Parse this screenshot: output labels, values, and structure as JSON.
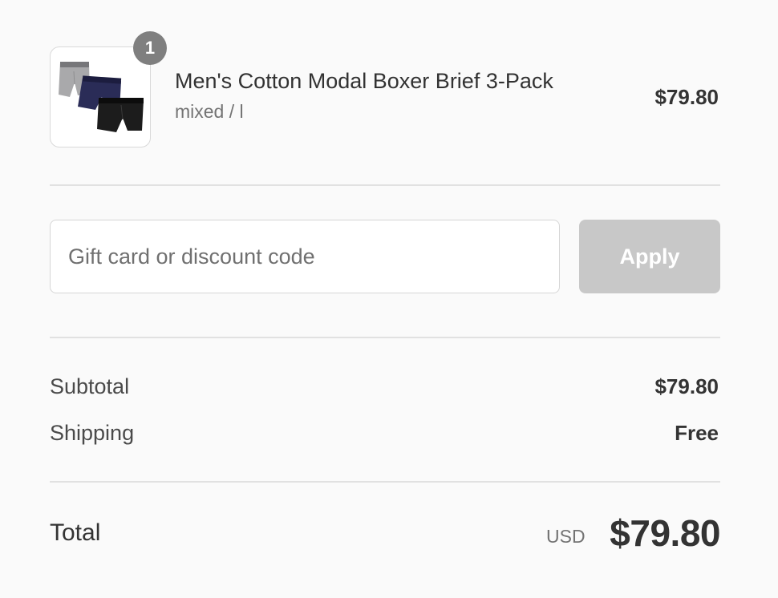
{
  "line_item": {
    "quantity": "1",
    "title": "Men's Cotton Modal Boxer Brief 3-Pack",
    "variant": "mixed / l",
    "price": "$79.80",
    "image_icon": "product-thumbnail-boxer-briefs",
    "image_colors": {
      "gray": "#a9a9ab",
      "navy": "#2a2c57",
      "black": "#1c1c1c"
    }
  },
  "discount": {
    "placeholder": "Gift card or discount code",
    "value": "",
    "apply_label": "Apply"
  },
  "totals": {
    "subtotal_label": "Subtotal",
    "subtotal_value": "$79.80",
    "shipping_label": "Shipping",
    "shipping_value": "Free",
    "total_label": "Total",
    "currency": "USD",
    "total_value": "$79.80"
  }
}
